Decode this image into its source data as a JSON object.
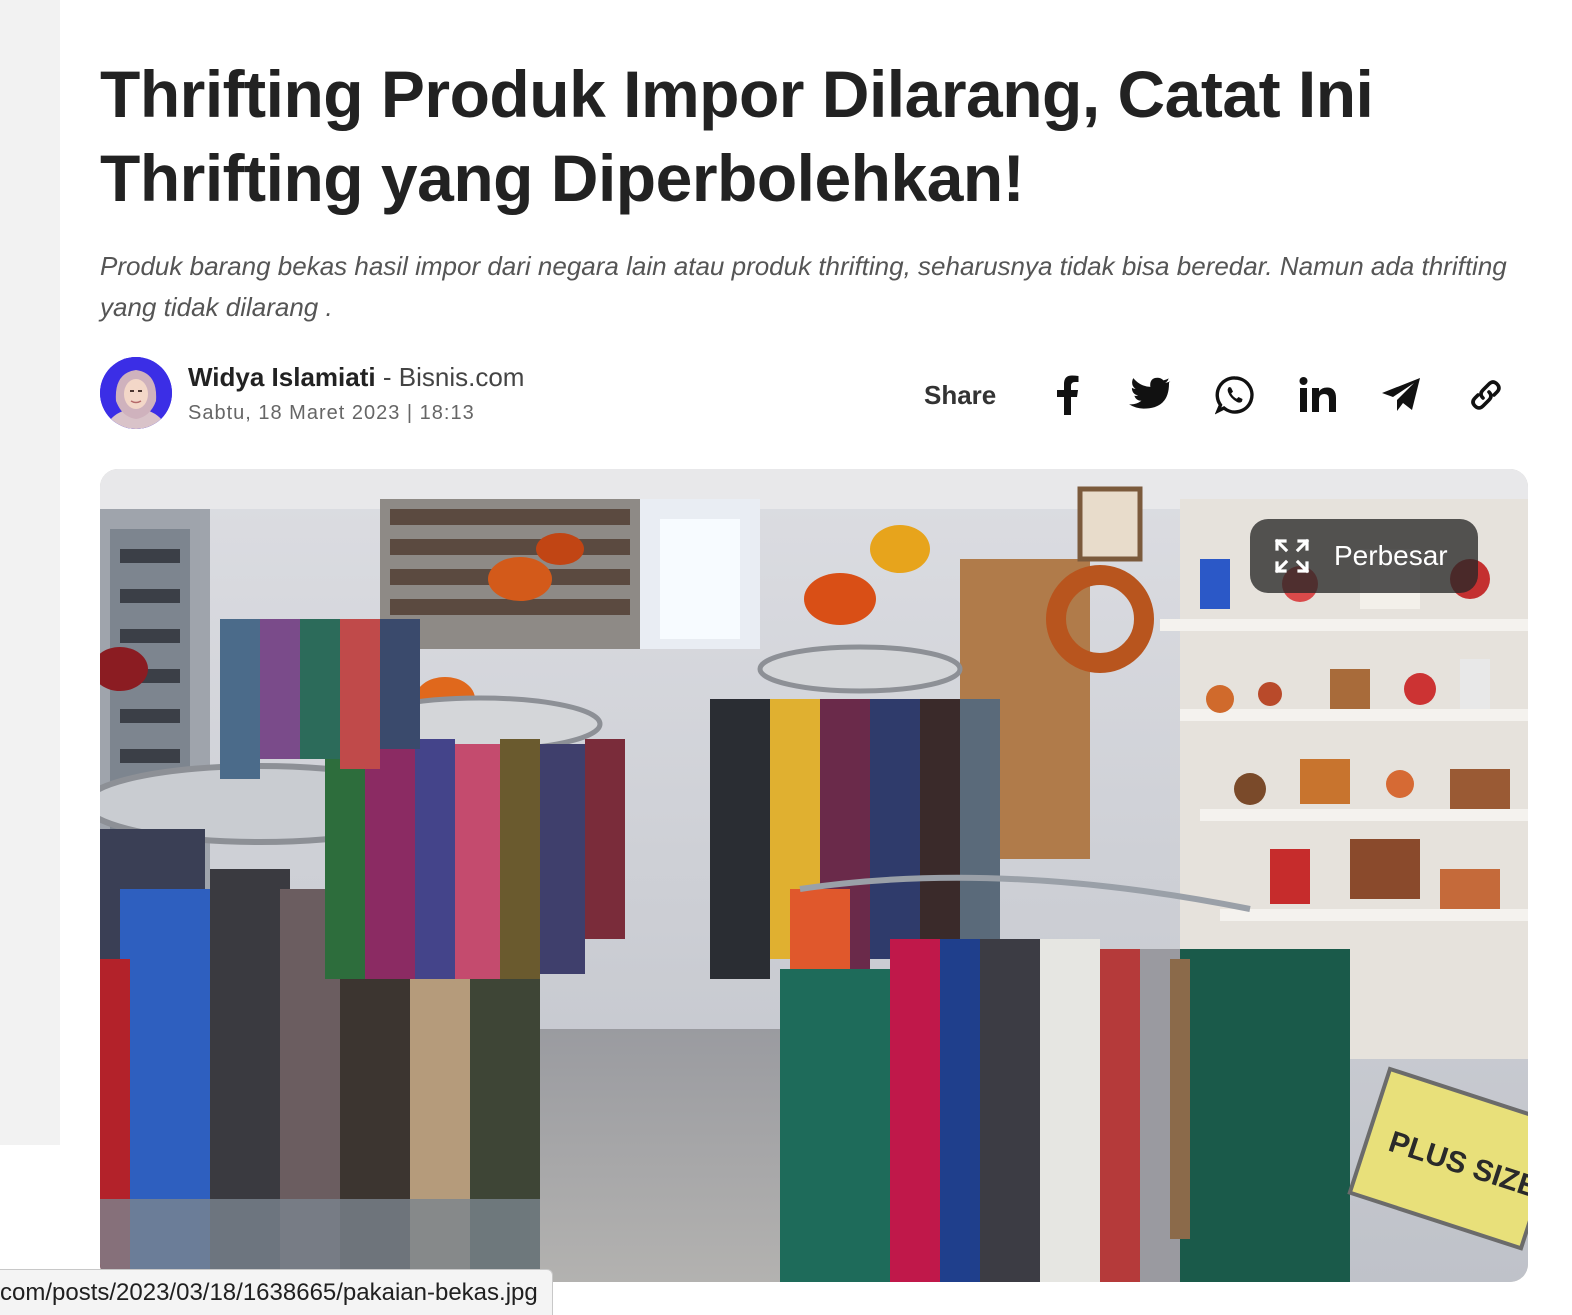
{
  "article": {
    "headline": "Thrifting Produk Impor Dilarang, Catat Ini Thrifting yang Diperbolehkan!",
    "lede": "Produk barang bekas hasil impor dari negara lain atau produk thrifting, seharusnya tidak bisa beredar. Namun ada thrifting yang tidak dilarang ."
  },
  "byline": {
    "author": "Widya Islamiati",
    "separator": "-",
    "source": "Bisnis.com",
    "timestamp": "Sabtu, 18 Maret 2023 | 18:13"
  },
  "share": {
    "label": "Share",
    "icons": [
      "facebook-icon",
      "twitter-icon",
      "whatsapp-icon",
      "linkedin-icon",
      "telegram-icon",
      "link-icon"
    ]
  },
  "hero": {
    "zoom_label": "Perbesar",
    "sign_text": "PLUS SIZE"
  },
  "status_bar": {
    "url": "com/posts/2023/03/18/1638665/pakaian-bekas.jpg"
  },
  "colors": {
    "avatar_bg": "#3b2ee6",
    "text": "#222222",
    "lede": "#555555"
  }
}
